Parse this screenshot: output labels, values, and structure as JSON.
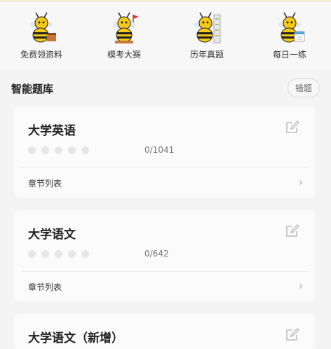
{
  "quick_actions": [
    {
      "label": "免费领资料",
      "icon": "bee-with-books-icon"
    },
    {
      "label": "模考大赛",
      "icon": "bee-with-flag-icon"
    },
    {
      "label": "历年真题",
      "icon": "bee-with-papers-icon"
    },
    {
      "label": "每日一练",
      "icon": "bee-with-calendar-icon"
    }
  ],
  "section": {
    "title": "智能题库",
    "wrong_button": "错题"
  },
  "courses": [
    {
      "title": "大学英语",
      "progress": "0/1041",
      "chapter_label": "章节列表",
      "chevron": "›"
    },
    {
      "title": "大学语文",
      "progress": "0/642",
      "chapter_label": "章节列表",
      "chevron": "›"
    },
    {
      "title": "大学语文（新增）"
    }
  ],
  "colors": {
    "background": "#f4f4f4",
    "card": "#fbfbfb",
    "bee_yellow": "#f5c81a",
    "text": "#222222"
  }
}
